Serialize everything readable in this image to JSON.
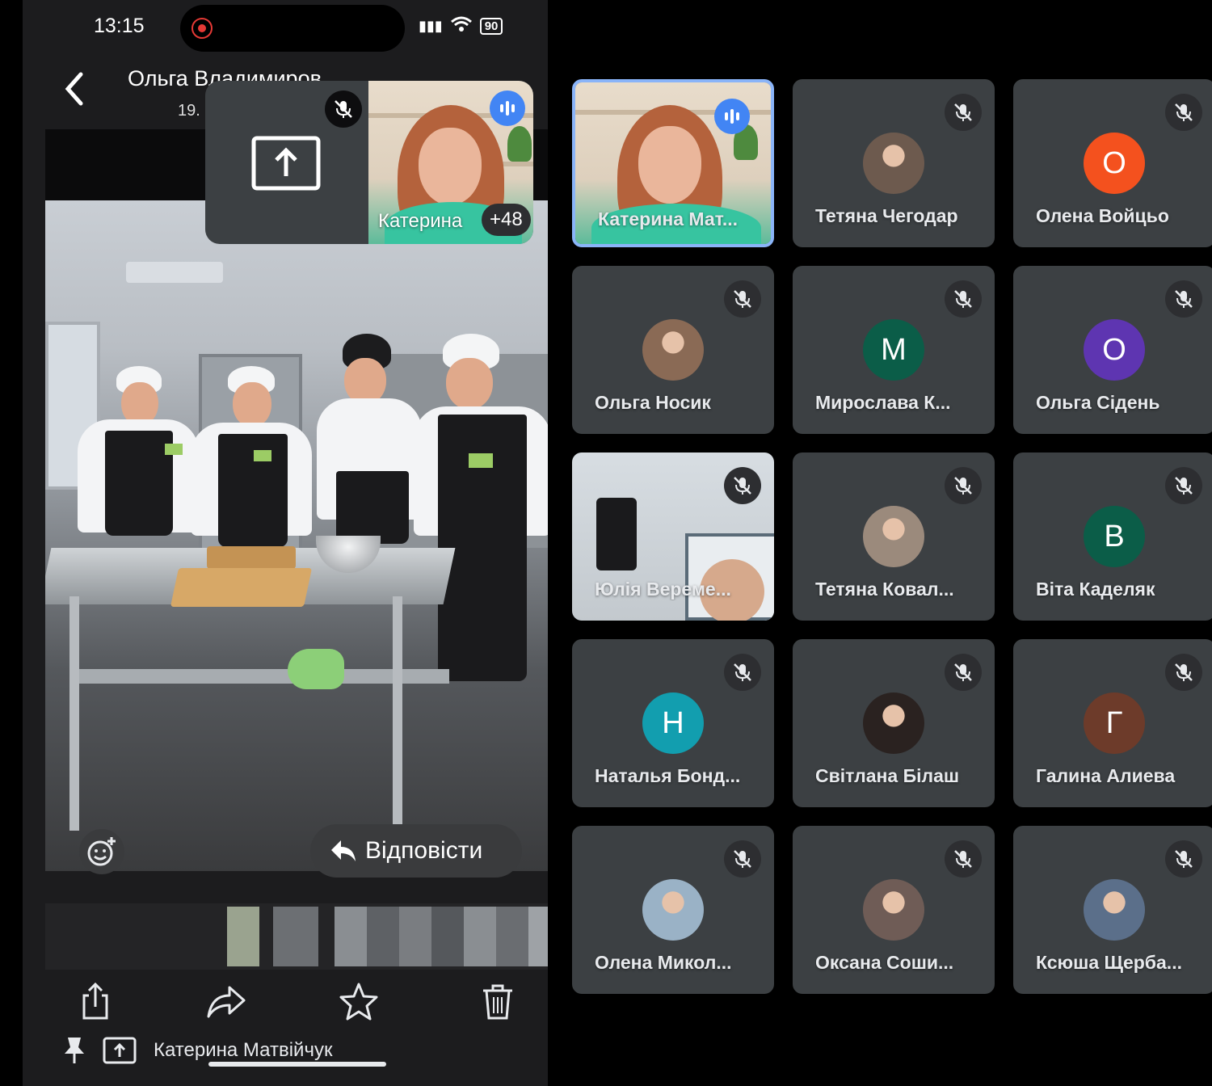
{
  "status_bar": {
    "time": "13:15",
    "battery": "90"
  },
  "viewer": {
    "sender_name": "Ольга Владимиров",
    "sub": "19.",
    "reply_label": "Відповісти",
    "bottom_label": "Катерина Матвійчук"
  },
  "self_view": {
    "label": "Катерина",
    "count": "+48"
  },
  "participants": [
    {
      "name": "Катерина Мат...",
      "type": "video",
      "active": true
    },
    {
      "name": "Тетяна Чегодар",
      "type": "photo",
      "photo_color": "#6d5a4e"
    },
    {
      "name": "Олена Войцьо",
      "type": "letter",
      "letter": "О",
      "color": "#f4511e"
    },
    {
      "name": "Ольга Носик",
      "type": "photo",
      "photo_color": "#8a6a55"
    },
    {
      "name": "Мирослава К...",
      "type": "letter",
      "letter": "М",
      "color": "#0b5d48"
    },
    {
      "name": "Ольга Сідень",
      "type": "letter",
      "letter": "О",
      "color": "#5e35b1"
    },
    {
      "name": "Юлія Вереме...",
      "type": "room"
    },
    {
      "name": "Тетяна Ковал...",
      "type": "photo",
      "photo_color": "#9b8a7c"
    },
    {
      "name": "Віта Каделяк",
      "type": "letter",
      "letter": "В",
      "color": "#0b5d48"
    },
    {
      "name": "Наталья Бонд...",
      "type": "letter",
      "letter": "Н",
      "color": "#129eaf"
    },
    {
      "name": "Світлана Білаш",
      "type": "photo",
      "photo_color": "#2a2220"
    },
    {
      "name": "Галина Алиева",
      "type": "letter",
      "letter": "Г",
      "color": "#6d3b2a"
    },
    {
      "name": "Олена Микол...",
      "type": "photo",
      "photo_color": "#9ab2c6"
    },
    {
      "name": "Оксана Соши...",
      "type": "photo",
      "photo_color": "#6f5c56"
    },
    {
      "name": "Ксюша Щерба...",
      "type": "photo",
      "photo_color": "#5b6f8a"
    }
  ],
  "colors": {
    "tile_bg": "#3c4043",
    "active_border": "#8ab4f8",
    "speaking": "#4285f4"
  }
}
